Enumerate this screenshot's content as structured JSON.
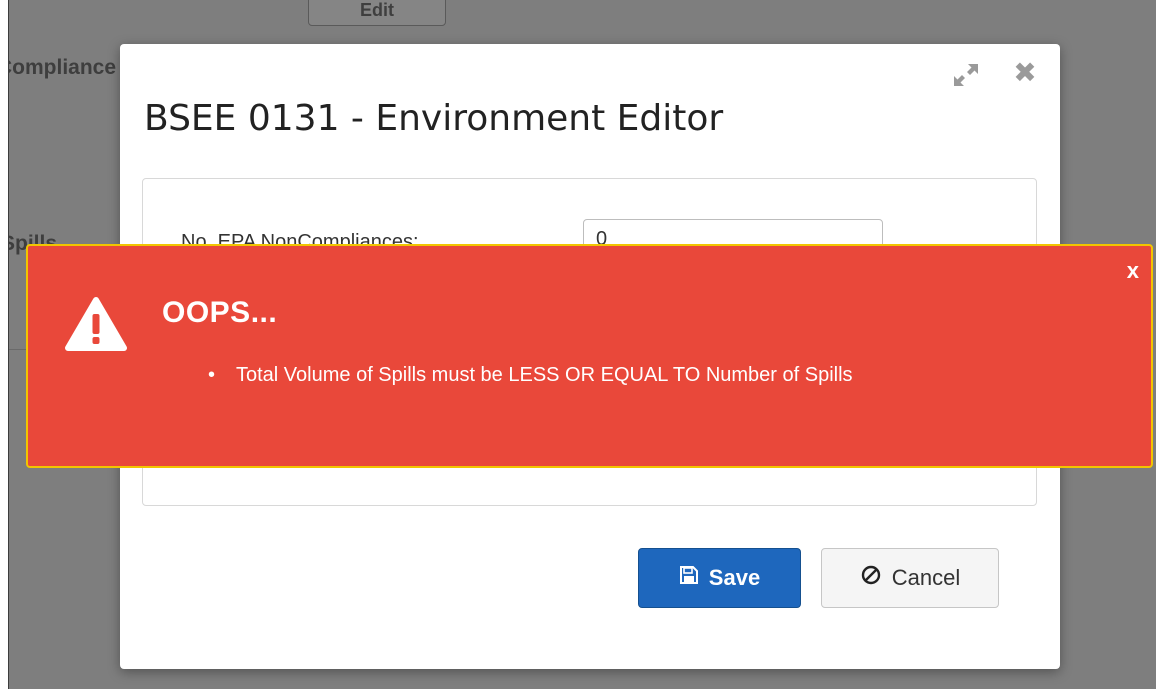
{
  "background": {
    "edit_label": "Edit",
    "compliance_label": "Compliance",
    "spills_label": "Spills"
  },
  "modal": {
    "title": "BSEE 0131 - Environment Editor",
    "field": {
      "label": "No. EPA NonCompliances:",
      "value": "0"
    },
    "save_label": "Save",
    "cancel_label": "Cancel"
  },
  "toast": {
    "close_label": "x",
    "title": "OOPS...",
    "messages": [
      "Total Volume of Spills must be LESS OR EQUAL TO Number of Spills"
    ]
  },
  "colors": {
    "toast_bg": "#e9483a",
    "toast_border": "#f2c500",
    "primary": "#1e67bd"
  },
  "icons": {
    "expand": "expand-icon",
    "close": "close-icon",
    "warning": "warning-triangle-icon",
    "save": "floppy-disk-icon",
    "cancel": "ban-icon"
  }
}
